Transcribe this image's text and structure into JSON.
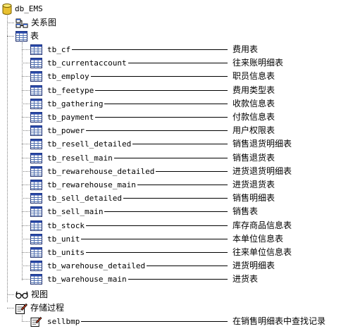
{
  "root": {
    "label": "db_EMS"
  },
  "diagrams": {
    "label": "关系图"
  },
  "tables": {
    "label": "表",
    "items": [
      {
        "name": "tb_cf",
        "desc": "费用表"
      },
      {
        "name": "tb_currentaccount",
        "desc": "往来账明细表"
      },
      {
        "name": "tb_employ",
        "desc": "职员信息表"
      },
      {
        "name": "tb_feetype",
        "desc": "费用类型表"
      },
      {
        "name": "tb_gathering",
        "desc": "收款信息表"
      },
      {
        "name": "tb_payment",
        "desc": "付款信息表"
      },
      {
        "name": "tb_power",
        "desc": "用户权限表"
      },
      {
        "name": "tb_resell_detailed",
        "desc": "销售退货明细表"
      },
      {
        "name": "tb_resell_main",
        "desc": "销售退货表"
      },
      {
        "name": "tb_rewarehouse_detailed",
        "desc": "进货退货明细表"
      },
      {
        "name": "tb_rewarehouse_main",
        "desc": "进货退货表"
      },
      {
        "name": "tb_sell_detailed",
        "desc": "销售明细表"
      },
      {
        "name": "tb_sell_main",
        "desc": "销售表"
      },
      {
        "name": "tb_stock",
        "desc": "库存商品信息表"
      },
      {
        "name": "tb_unit",
        "desc": "本单位信息表"
      },
      {
        "name": "tb_units",
        "desc": "往来单位信息表"
      },
      {
        "name": "tb_warehouse_detailed",
        "desc": "进货明细表"
      },
      {
        "name": "tb_warehouse_main",
        "desc": "进货表"
      }
    ]
  },
  "views": {
    "label": "视图"
  },
  "procedures": {
    "label": "存储过程",
    "items": [
      {
        "name": "sellbmp",
        "desc": "在销售明细表中查找记录"
      }
    ]
  }
}
